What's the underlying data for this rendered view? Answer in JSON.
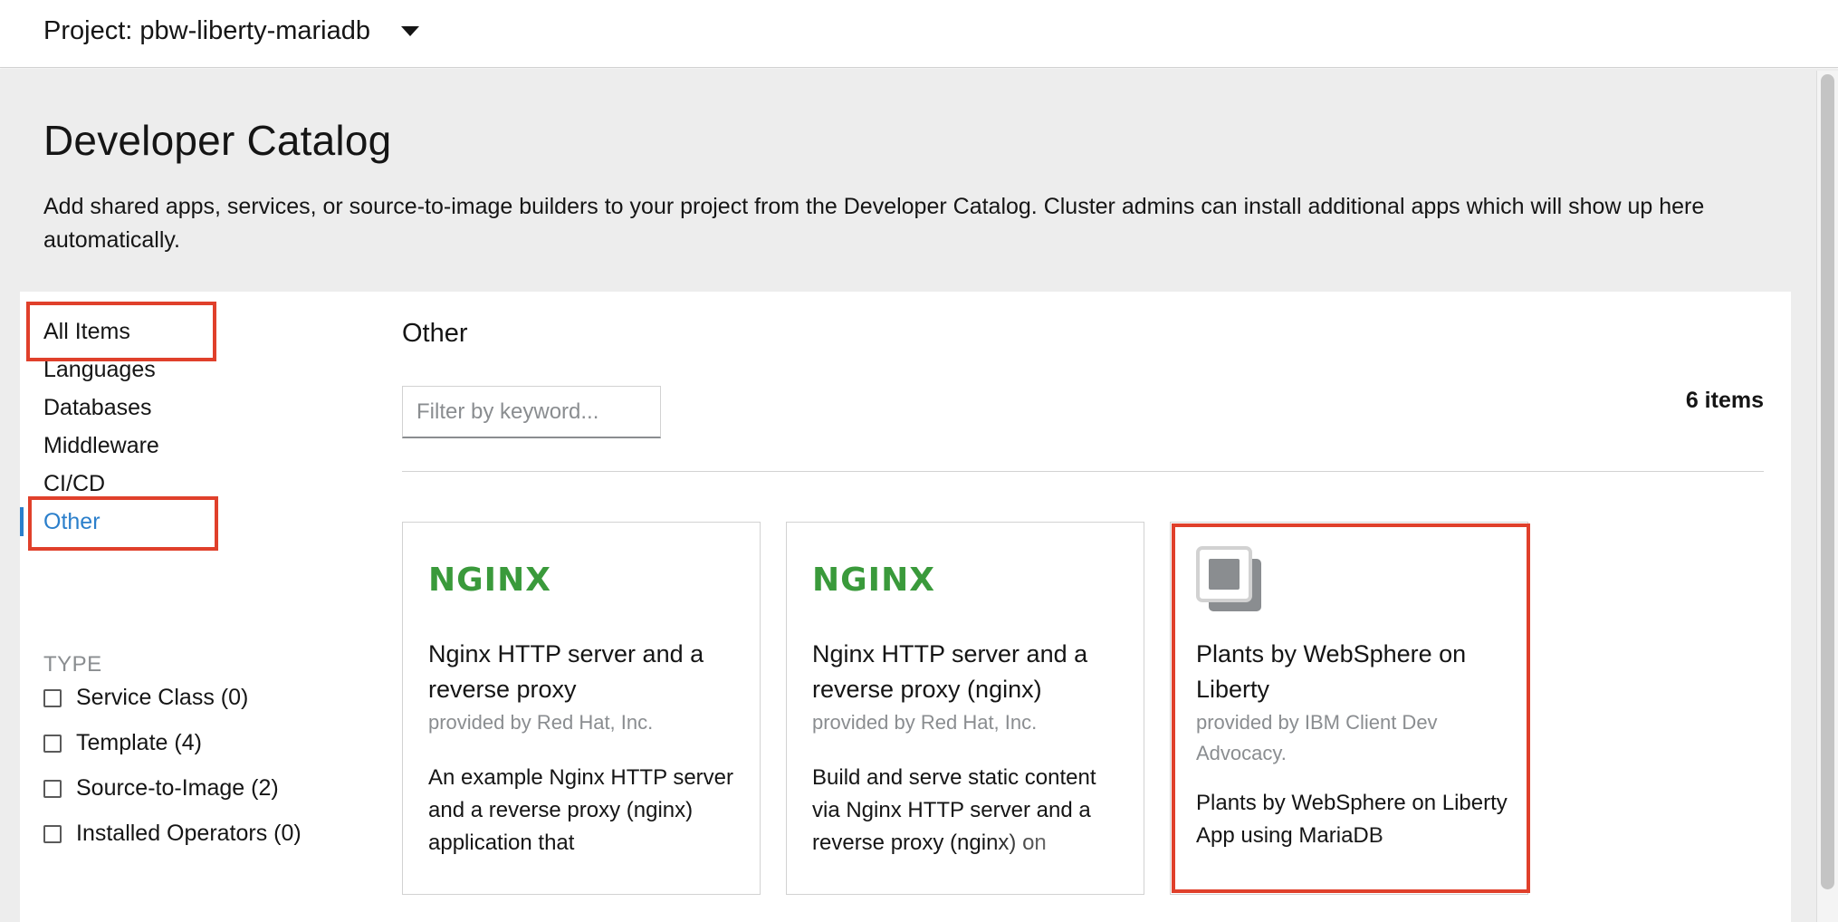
{
  "project_bar": {
    "label": "Project: pbw-liberty-mariadb",
    "dropdown_icon": "caret-down-icon"
  },
  "header": {
    "title": "Developer Catalog",
    "description": "Add shared apps, services, or source-to-image builders to your project from the Developer Catalog. Cluster admins can install additional apps which will show up here automatically."
  },
  "sidebar": {
    "items": [
      {
        "label": "All Items"
      },
      {
        "label": "Languages"
      },
      {
        "label": "Databases"
      },
      {
        "label": "Middleware"
      },
      {
        "label": "CI/CD"
      },
      {
        "label": "Other"
      }
    ],
    "active_item": "Other",
    "type_heading": "TYPE",
    "type_filters": [
      {
        "label": "Service Class (0)",
        "checked": false
      },
      {
        "label": "Template (4)",
        "checked": false
      },
      {
        "label": "Source-to-Image (2)",
        "checked": false
      },
      {
        "label": "Installed Operators (0)",
        "checked": false
      }
    ]
  },
  "main": {
    "title": "Other",
    "filter_placeholder": "Filter by keyword...",
    "item_count": "6 items",
    "tiles": [
      {
        "logo": "NGINX",
        "logo_icon": "nginx-logo",
        "title": "Nginx HTTP server and a reverse proxy",
        "provider": "provided by Red Hat, Inc.",
        "description": "An example Nginx HTTP server and a reverse proxy (nginx) application that"
      },
      {
        "logo": "NGINX",
        "logo_icon": "nginx-logo",
        "title": "Nginx HTTP server and a reverse proxy (nginx)",
        "provider": "provided by Red Hat, Inc.",
        "description": "Build and serve static content via Nginx HTTP server and a reverse proxy (nginx) on"
      },
      {
        "logo_icon": "generic-app-icon",
        "title": "Plants by WebSphere on Liberty",
        "provider": "provided by IBM Client Dev Advocacy.",
        "description": "Plants by WebSphere on Liberty App using MariaDB"
      }
    ]
  },
  "colors": {
    "accent_blue": "#2b7fcb",
    "highlight_red": "#e0402b",
    "nginx_green": "#3a9a3b",
    "page_background": "#ededed"
  }
}
